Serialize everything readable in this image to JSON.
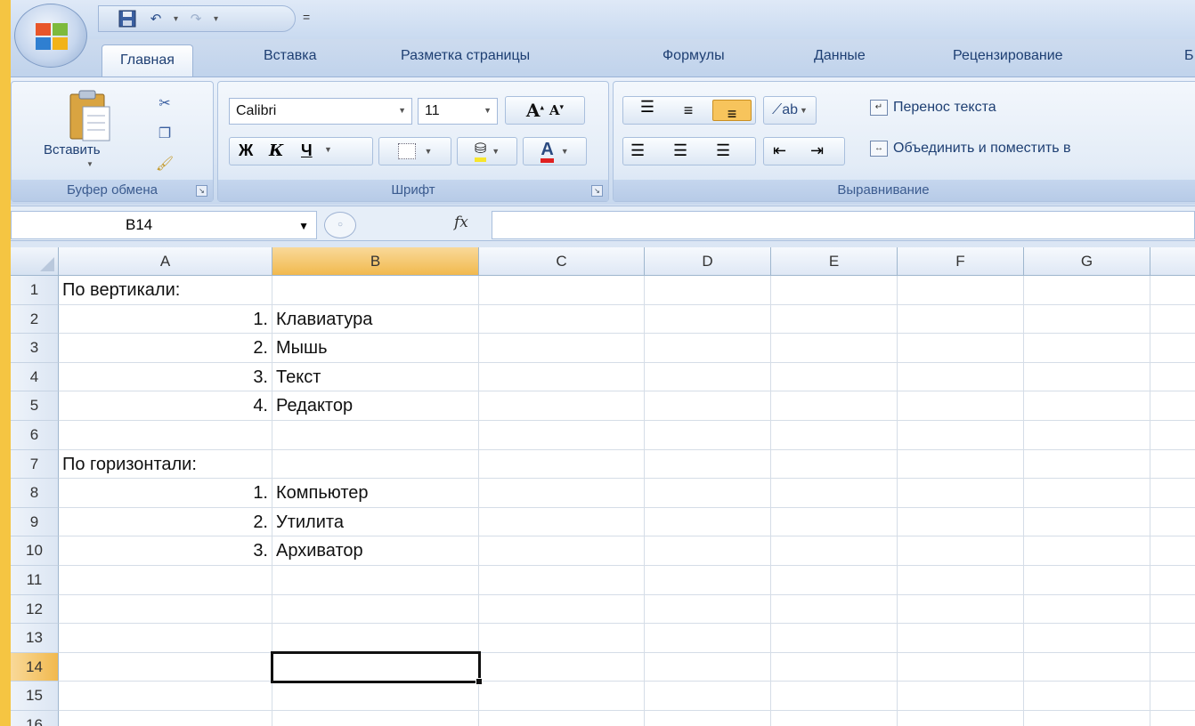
{
  "quick_access": {
    "more_label": "="
  },
  "tabs": [
    "Главная",
    "Вставка",
    "Разметка страницы",
    "Формулы",
    "Данные",
    "Рецензирование",
    "Б"
  ],
  "ribbon": {
    "clipboard": {
      "paste_label": "Вставить",
      "group_label": "Буфер обмена"
    },
    "font": {
      "font_name": "Calibri",
      "font_size": "11",
      "bold": "Ж",
      "italic": "К",
      "underline": "Ч",
      "group_label": "Шрифт"
    },
    "alignment": {
      "wrap_text": "Перенос текста",
      "merge_center": "Объединить и поместить в",
      "group_label": "Выравнивание"
    }
  },
  "formula_bar": {
    "name_box": "B14",
    "fx": "fx",
    "formula": ""
  },
  "sheet": {
    "columns": [
      "A",
      "B",
      "C",
      "D",
      "E",
      "F",
      "G"
    ],
    "selected_column": "B",
    "selected_row": "14",
    "selected_cell": "B14",
    "rows": [
      {
        "num": "1",
        "a": "По вертикали:",
        "b": ""
      },
      {
        "num": "2",
        "a": "1.",
        "b": "Клавиатура"
      },
      {
        "num": "3",
        "a": "2.",
        "b": "Мышь"
      },
      {
        "num": "4",
        "a": "3.",
        "b": "Текст"
      },
      {
        "num": "5",
        "a": "4.",
        "b": "Редактор"
      },
      {
        "num": "6",
        "a": "",
        "b": ""
      },
      {
        "num": "7",
        "a": "По горизонтали:",
        "b": ""
      },
      {
        "num": "8",
        "a": "1.",
        "b": "Компьютер"
      },
      {
        "num": "9",
        "a": "2.",
        "b": "Утилита"
      },
      {
        "num": "10",
        "a": "3.",
        "b": "Архиватор"
      },
      {
        "num": "11",
        "a": "",
        "b": ""
      },
      {
        "num": "12",
        "a": "",
        "b": ""
      },
      {
        "num": "13",
        "a": "",
        "b": ""
      },
      {
        "num": "14",
        "a": "",
        "b": ""
      },
      {
        "num": "15",
        "a": "",
        "b": ""
      },
      {
        "num": "16",
        "a": "",
        "b": ""
      }
    ]
  },
  "colors": {
    "frame": "#f5c542",
    "selection_header": "#f1b94e",
    "ribbon": "#dbe6f4"
  }
}
